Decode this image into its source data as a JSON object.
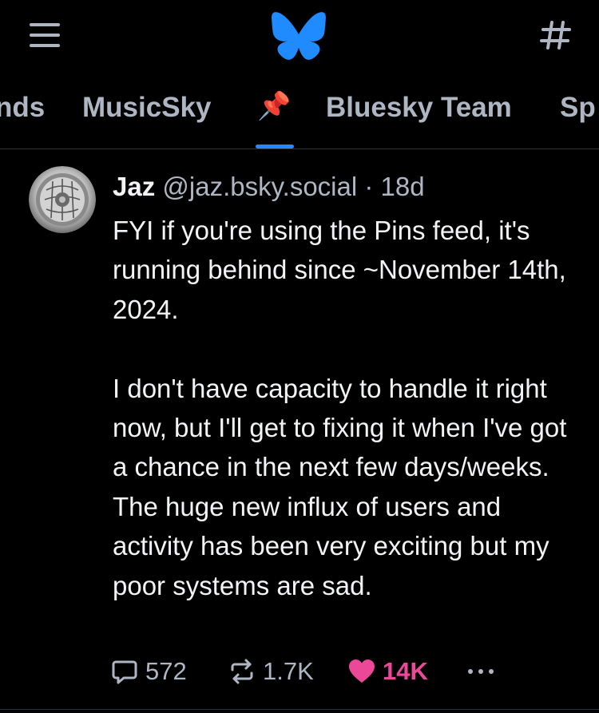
{
  "app": {
    "accent_color": "#208bfe",
    "like_color": "#ec4899",
    "icons": {
      "menu": "hamburger-menu-icon",
      "logo": "bluesky-butterfly-icon",
      "feeds": "hashtag-icon",
      "pin": "pushpin-emoji"
    }
  },
  "tabs": {
    "items": [
      {
        "label": "nds"
      },
      {
        "label": "MusicSky"
      },
      {
        "label": "📌"
      },
      {
        "label": "Bluesky Team"
      },
      {
        "label": "Sp"
      }
    ],
    "active_index": 2
  },
  "post": {
    "author": {
      "name": "Jaz",
      "handle": "@jaz.bsky.social"
    },
    "separator": "·",
    "age": "18d",
    "body": [
      "FYI if you're using the Pins feed, it's running behind since ~November 14th, 2024.",
      "I don't have capacity to handle it right now, but I'll get to fixing it when I've got a chance in the next few days/weeks. The huge new influx of users and activity has been very exciting but my poor systems are sad."
    ],
    "actions": {
      "replies": "572",
      "reposts": "1.7K",
      "likes": "14K",
      "liked": true
    }
  }
}
